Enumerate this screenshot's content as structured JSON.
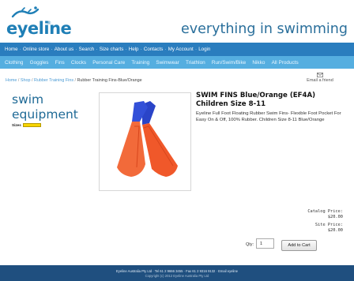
{
  "header": {
    "logo_text": "eyeline",
    "logo_mark": "®",
    "tagline": "everything in swimming",
    "brand_color": "#1f7fb6"
  },
  "nav_primary": {
    "items": [
      "Home",
      "Online store",
      "About us",
      "Search",
      "Size charts",
      "Help",
      "Contacts",
      "My Account",
      "Login"
    ],
    "separator": "·",
    "background": "#2a7dbe"
  },
  "nav_categories": {
    "items": [
      "Clothing",
      "Goggles",
      "Fins",
      "Clocks",
      "Personal Care",
      "Training",
      "Swimwear",
      "Triathlon",
      "Run/Swim/Bike",
      "Nikko",
      "All Products"
    ],
    "background": "#55aee0"
  },
  "breadcrumb": {
    "links": [
      "Home",
      "Shop",
      "Rubber Training Fins"
    ],
    "separator": "/",
    "current": "Rubber Training Fins-Blue/Orange"
  },
  "email_friend": {
    "label": "Email a friend",
    "icon": "envelope-icon"
  },
  "section": {
    "title": "swim equipment",
    "sizes_label": "Sizes",
    "sizes_badge_color": "#f7d400"
  },
  "product": {
    "title": "SWIM FINS Blue/Orange (EF4A) Children Size 8-11",
    "description": "Eyeline Full Foot Floating Rubber Swim Fins- Flexible Foot Pocket For Easy On & Off, 100% Rubber. Children Size 8-11 Blue/Orange",
    "image": "swim-fins-blue-orange",
    "fin_colors": {
      "foot": "#2a44c8",
      "blade": "#f0582a"
    },
    "catalog_price_label": "Catalog Price:",
    "catalog_price": "$20.00",
    "site_price_label": "Site Price:",
    "site_price": "$20.00"
  },
  "cart": {
    "qty_label": "Qty:",
    "qty_value": "1",
    "add_label": "Add to Cart"
  },
  "footer": {
    "line1": "Eyeline Australia Pty Ltd · Tel 61 2 9666 3455 · Fax 61 2 9316 9132 · Email eyeline",
    "line2": "Copyright (c) 2012 Eyeline Australia Pty Ltd",
    "background": "#1f4f7f"
  }
}
